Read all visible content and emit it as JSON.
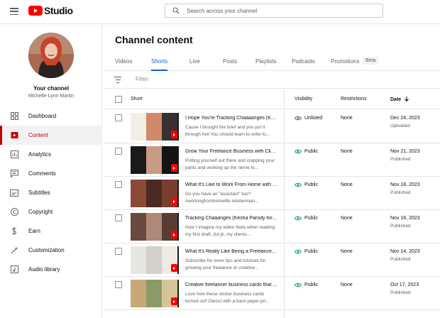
{
  "app": {
    "logo_text": "Studio"
  },
  "search": {
    "placeholder": "Search across your channel"
  },
  "channel": {
    "title": "Your channel",
    "name": "Michelle Lynn Martin"
  },
  "sidebar": {
    "items": [
      {
        "label": "Dashboard",
        "icon": "dashboard-icon",
        "active": false
      },
      {
        "label": "Content",
        "icon": "content-icon",
        "active": true
      },
      {
        "label": "Analytics",
        "icon": "analytics-icon",
        "active": false
      },
      {
        "label": "Comments",
        "icon": "comments-icon",
        "active": false
      },
      {
        "label": "Subtitles",
        "icon": "subtitles-icon",
        "active": false
      },
      {
        "label": "Copyright",
        "icon": "copyright-icon",
        "active": false
      },
      {
        "label": "Earn",
        "icon": "earn-icon",
        "active": false
      },
      {
        "label": "Customization",
        "icon": "customization-icon",
        "active": false
      },
      {
        "label": "Audio library",
        "icon": "audio-library-icon",
        "active": false
      }
    ]
  },
  "main": {
    "title": "Channel content",
    "tabs": [
      {
        "label": "Videos",
        "active": false
      },
      {
        "label": "Shorts",
        "active": true
      },
      {
        "label": "Live",
        "active": false
      },
      {
        "label": "Posts",
        "active": false
      },
      {
        "label": "Playlists",
        "active": false
      },
      {
        "label": "Podcasts",
        "active": false
      },
      {
        "label": "Promotions",
        "active": false
      }
    ],
    "badge": "Beta",
    "filter_placeholder": "Filter",
    "columns": {
      "short": "Short",
      "visibility": "Visibility",
      "restrictions": "Restrictions",
      "date": "Date"
    },
    "rows": [
      {
        "title": "I Hope You're Tracking Chaaaanges (Kes...",
        "description": "Cause I brought the brief and you put it through hell You should learn to write fo...",
        "visibility": "Unlisted",
        "restrictions": "None",
        "date": "Dec 24, 2023",
        "status": "Uploaded"
      },
      {
        "title": "Grow Your Freelance Business with Client...",
        "description": "Putting yourself out there and crapping your pants and working up the nerve to...",
        "visibility": "Public",
        "restrictions": "None",
        "date": "Nov 21, 2023",
        "status": "Published"
      },
      {
        "title": "What It's Like to Work From Home with a...",
        "description": "Do you have an \"assistant\" too? #workingfromhomelife #doberman...",
        "visibility": "Public",
        "restrictions": "None",
        "date": "Nov 18, 2023",
        "status": "Published"
      },
      {
        "title": "Tracking Chaaanges (Kesha Parody for...",
        "description": "How I imagine my editor feels when reading my first draft. (lol jk, my clients...",
        "visibility": "Public",
        "restrictions": "None",
        "date": "Nov 16, 2023",
        "status": "Published"
      },
      {
        "title": "What It's Really Like Being a Freelance...",
        "description": "Subscribe for more tips and tutorials for growing your freelance or creative...",
        "visibility": "Public",
        "restrictions": "None",
        "date": "Nov 14, 2023",
        "status": "Published"
      },
      {
        "title": "Creative freelancer business cards that ...",
        "description": "Love how these sticker business cards turned out! Diecut with a back paper pri...",
        "visibility": "Public",
        "restrictions": "None",
        "date": "Oct 17, 2023",
        "status": "Published"
      }
    ]
  },
  "colors": {
    "accent_red": "#cc0000",
    "link_blue": "#065fd4",
    "public_green": "#0f9d58"
  }
}
